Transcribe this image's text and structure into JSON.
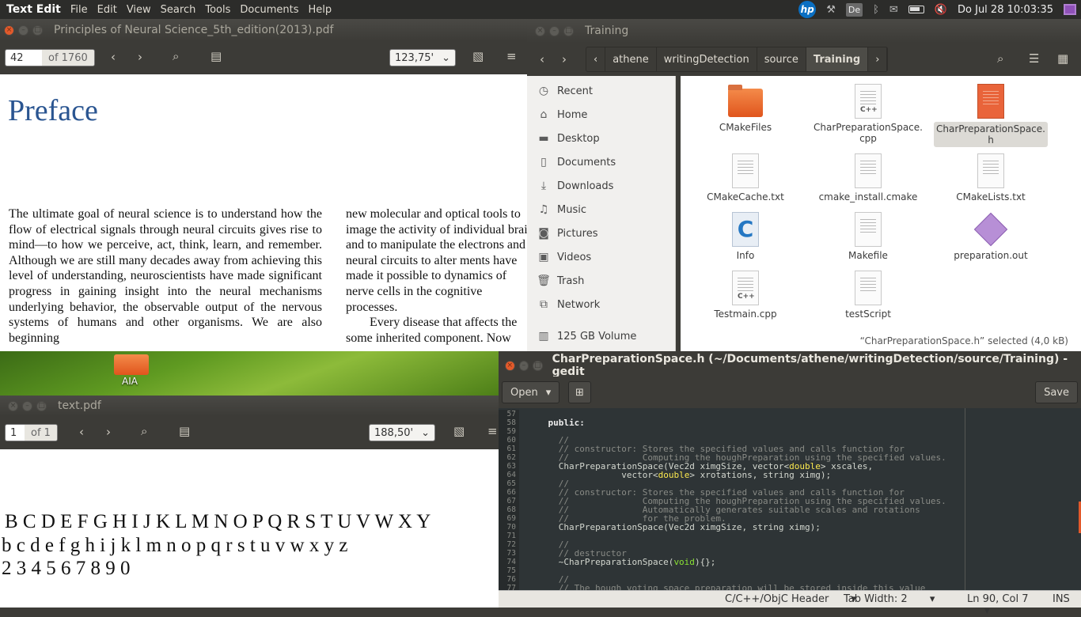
{
  "topbar": {
    "app_name": "Text Edit",
    "menu": [
      "File",
      "Edit",
      "View",
      "Search",
      "Tools",
      "Documents",
      "Help"
    ],
    "indicator": "De",
    "clock": "Do Jul 28 10:03:35"
  },
  "evince1": {
    "title": "Principles of Neural Science_5th_edition(2013).pdf",
    "page": "42",
    "page_total": "of 1760",
    "zoom": "123,75'",
    "heading": "Preface",
    "col1": "The ultimate goal of neural science is to understand how the flow of electrical signals through neural circuits gives rise to mind—to how we perceive, act, think, learn, and remember. Although we are still many decades away from achieving this level of understanding, neuroscientists have made significant progress in gaining insight into the neural mechanisms underlying behavior, the observable output of the nervous systems of humans and other organisms. We are also beginning",
    "col2": "new molecular and optical tools to image the activity of individual brain and to manipulate the electrons and neural circuits to alter ments have made it possible to dynamics of nerve cells in the cognitive processes.",
    "col2b": "Every disease that affects the some inherited component. Now"
  },
  "files": {
    "title": "Training",
    "crumbs": [
      "athene",
      "writingDetection",
      "source",
      "Training"
    ],
    "sidebar": [
      "Recent",
      "Home",
      "Desktop",
      "Documents",
      "Downloads",
      "Music",
      "Pictures",
      "Videos",
      "Trash",
      "Network",
      "125 GB Volume"
    ],
    "items": [
      "CMakeFiles",
      "CharPreparationSpace.\ncpp",
      "CharPreparationSpace.\nh",
      "CMakeCache.txt",
      "cmake_install.cmake",
      "CMakeLists.txt",
      "Info",
      "Makefile",
      "preparation.out",
      "Testmain.cpp",
      "testScript"
    ],
    "status": "“CharPreparationSpace.h” selected  (4,0 kB)"
  },
  "desktop": {
    "icon_label": "AIA"
  },
  "evince2": {
    "title": "text.pdf",
    "page": "1",
    "page_total": "of 1",
    "zoom": "188,50'",
    "line1": "B C D E F G H I J K L M N O P Q R S T U V W X Y",
    "line2": "b c d e f g h i j k l m n o p q r s t u v w x y z",
    "line3": "2 3 4 5 6 7 8 9 0"
  },
  "gedit": {
    "title": "CharPreparationSpace.h (~/Documents/athene/writingDetection/source/Training) - gedit",
    "open_label": "Open",
    "save_label": "Save",
    "line_numbers": [
      "57",
      "58",
      "59",
      "60",
      "61",
      "62",
      "63",
      "64",
      "65",
      "66",
      "67",
      "68",
      "69",
      "70",
      "71",
      "72",
      "73",
      "74",
      "75",
      "76",
      "77"
    ],
    "status_lang": "C/C++/ObjC Header",
    "status_tab": "Tab Width: 2",
    "status_pos": "Ln 90, Col 7",
    "status_mode": "INS"
  }
}
